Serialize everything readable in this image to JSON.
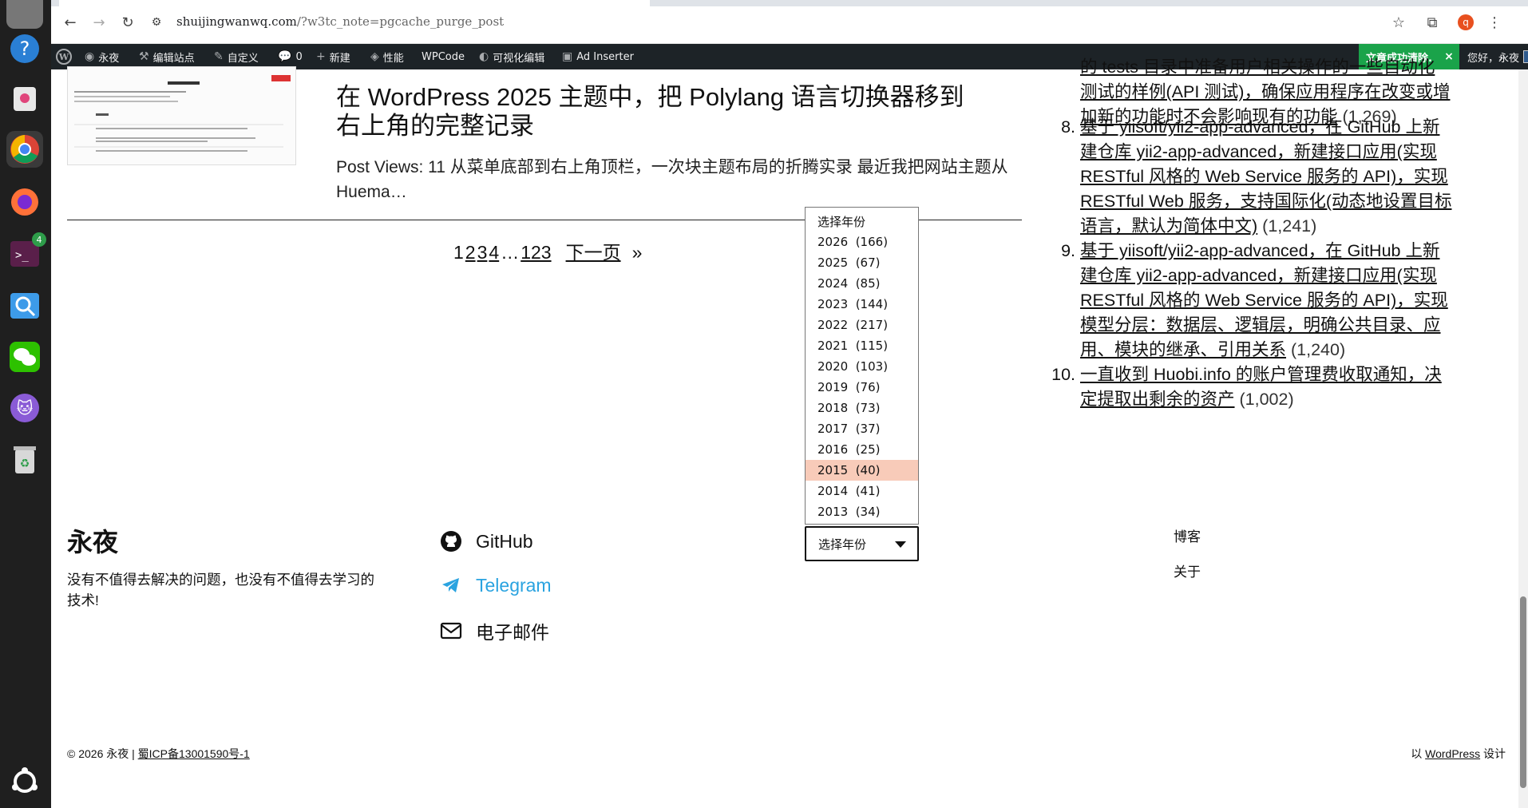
{
  "browser": {
    "url_domain": "shuijingwanwq.com",
    "url_path": "/?w3tc_note=pgcache_purge_post",
    "profile_initial": "q"
  },
  "adminbar": {
    "site_name": "永夜",
    "edit_site": "编辑站点",
    "customize": "自定义",
    "comments_count": "0",
    "new": "新建",
    "performance": "性能",
    "wpcode": "WPCode",
    "visual_edit": "可视化编辑",
    "ad_inserter": "Ad Inserter",
    "notice": "文章成功清除.",
    "notice_close": "×",
    "greeting": "您好，永夜"
  },
  "post": {
    "title": "在 WordPress 2025 主题中，把 Polylang 语言切换器移到右上角的完整记录",
    "excerpt": "Post Views: 11 从菜单底部到右上角顶栏，一次块主题布局的折腾实录 最近我把网站主题从 Huema…"
  },
  "pagination": {
    "current": "1",
    "pages": [
      "2",
      "3",
      "4"
    ],
    "ellipsis": "…",
    "last": "123",
    "next": "下一页",
    "arrow": "»"
  },
  "sidebar": {
    "items": [
      {
        "num": "",
        "lines": [
          "的 tests 目录中准备用户相关操作的一些自动化",
          "测试的样例(API 测试)，确保应用程序在改变或增",
          "加新的功能时不会影响现有的功能"
        ],
        "count": "(1,269)"
      },
      {
        "num": "8.",
        "lines": [
          "基于 yiisoft/yii2-app-advanced，在 GitHub 上新",
          "建仓库 yii2-app-advanced，新建接口应用(实现",
          "RESTful 风格的 Web Service 服务的 API)，实现",
          "RESTful Web 服务，支持国际化(动态地设置目标",
          "语言，默认为简体中文)"
        ],
        "count": "(1,241)"
      },
      {
        "num": "9.",
        "lines": [
          "基于 yiisoft/yii2-app-advanced，在 GitHub 上新",
          "建仓库 yii2-app-advanced，新建接口应用(实现",
          "RESTful 风格的 Web Service 服务的 API)，实现",
          "模型分层：数据层、逻辑层，明确公共目录、应",
          "用、模块的继承、引用关系"
        ],
        "count": "(1,240)"
      },
      {
        "num": "10.",
        "lines": [
          "一直收到 Huobi.info 的账户管理费收取通知，决",
          "定提取出剩余的资产"
        ],
        "count": "(1,002)"
      }
    ]
  },
  "footer": {
    "site_title": "永夜",
    "tagline": "没有不值得去解决的问题，也没有不值得去学习的技术!",
    "social": [
      {
        "label": "GitHub",
        "icon": "github-icon",
        "color": "#111111"
      },
      {
        "label": "Telegram",
        "icon": "telegram-icon",
        "color": "#2aa3e0"
      },
      {
        "label": "电子邮件",
        "icon": "mail-icon",
        "color": "#111111"
      }
    ],
    "archive_select": {
      "placeholder": "选择年份",
      "options": [
        "选择年份",
        "2026  (166)",
        "2025  (67)",
        "2024  (85)",
        "2023  (144)",
        "2022  (217)",
        "2021  (115)",
        "2020  (103)",
        "2019  (76)",
        "2018  (73)",
        "2017  (37)",
        "2016  (25)",
        "2015  (40)",
        "2014  (41)",
        "2013  (34)"
      ],
      "highlighted": "2015  (40)"
    },
    "menu": [
      "博客",
      "关于"
    ],
    "copyright_prefix": "© 2026 永夜 | ",
    "icp": "蜀ICP备13001590号-1",
    "credit_prefix": "以 ",
    "credit_link": "WordPress",
    "credit_suffix": " 设计"
  },
  "colors": {
    "adminbar_bg": "#1d2327",
    "notice_bg": "#1aa34a",
    "dropdown_highlight": "#f8cbb9",
    "telegram": "#2aa3e0"
  }
}
